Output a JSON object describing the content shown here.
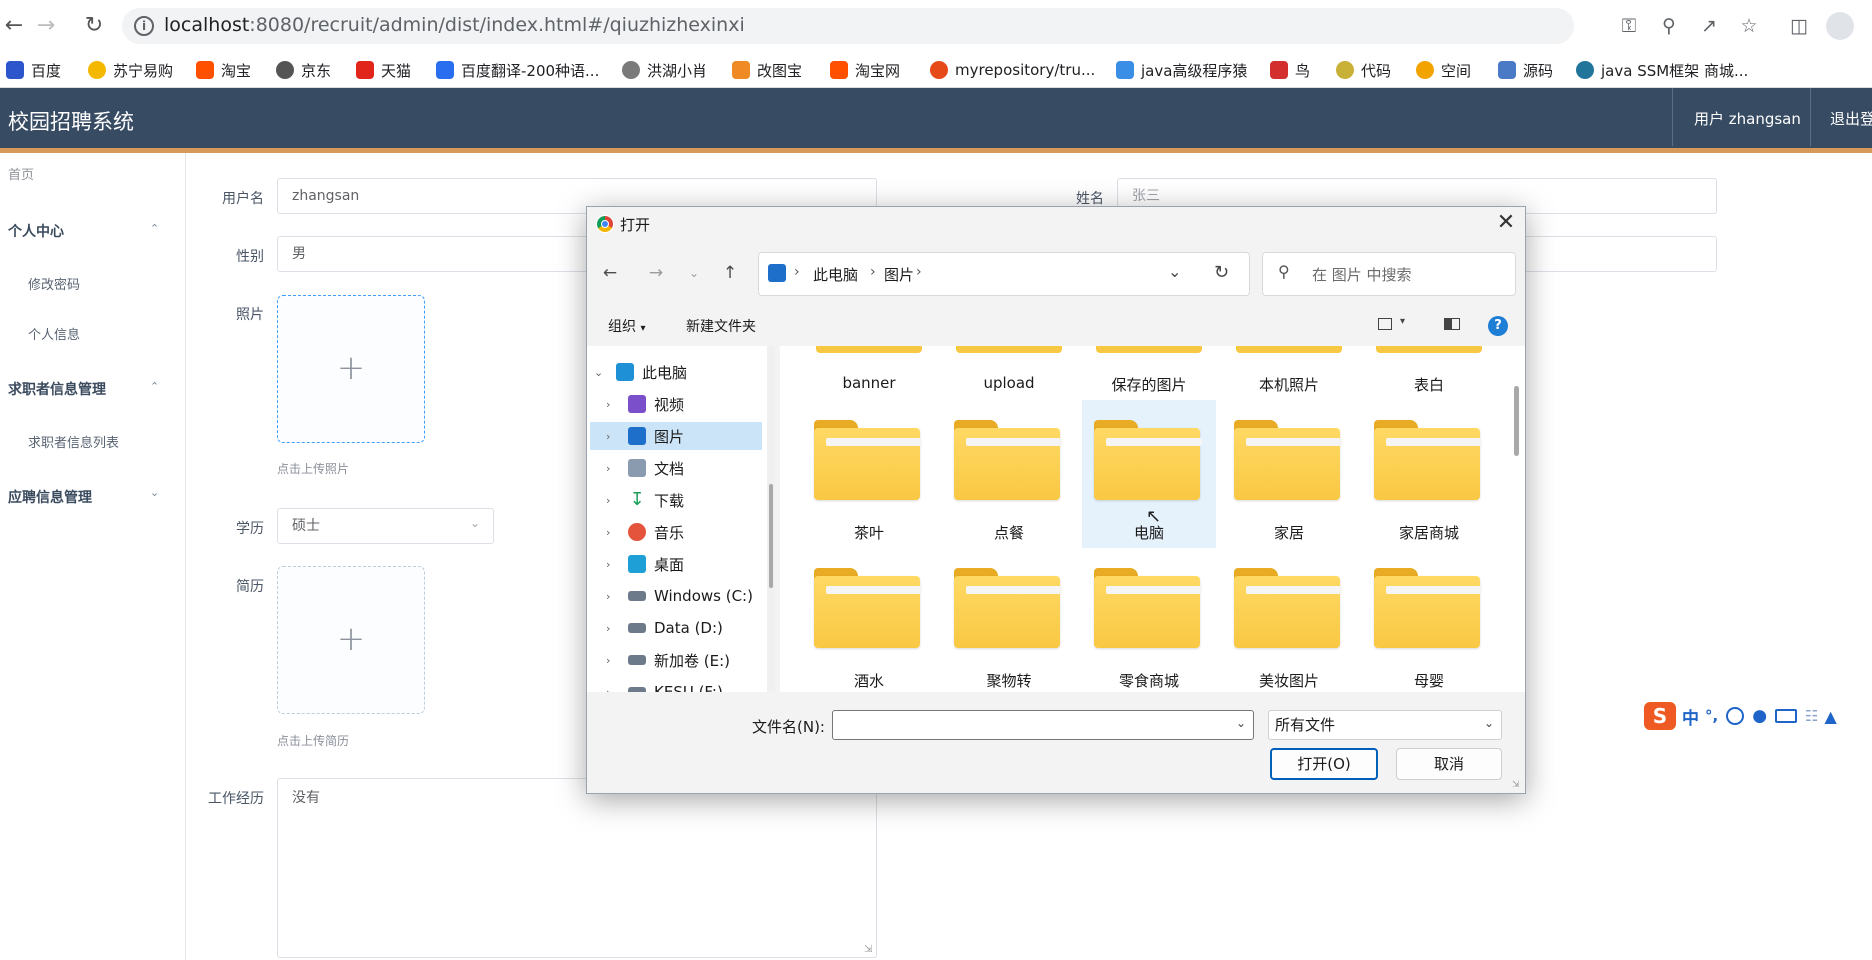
{
  "browser": {
    "url_host": "localhost",
    "url_path": ":8080/recruit/admin/dist/index.html#/qiuzhizhexinxi",
    "bookmarks": [
      {
        "label": "百度",
        "color": "#2d55cc"
      },
      {
        "label": "苏宁易购",
        "color": "#f5b800"
      },
      {
        "label": "淘宝",
        "color": "#ff5000"
      },
      {
        "label": "京东",
        "color": "#555555"
      },
      {
        "label": "天猫",
        "color": "#e1251b"
      },
      {
        "label": "百度翻译-200种语...",
        "color": "#2a6ef0"
      },
      {
        "label": "洪湖小肖",
        "color": "#7a7a7a"
      },
      {
        "label": "改图宝",
        "color": "#f08a24"
      },
      {
        "label": "淘宝网",
        "color": "#ff5000"
      },
      {
        "label": "myrepository/tru...",
        "color": "#e64a19"
      },
      {
        "label": "java高级程序猿",
        "color": "#3a8ee6"
      },
      {
        "label": "鸟",
        "color": "#d32f2f"
      },
      {
        "label": "代码",
        "color": "#c9b037"
      },
      {
        "label": "空间",
        "color": "#f2a300"
      },
      {
        "label": "源码",
        "color": "#4a7ac6"
      },
      {
        "label": "java SSM框架 商城...",
        "color": "#21759b"
      }
    ]
  },
  "app": {
    "title": "校园招聘系统",
    "user_label": "用户 zhangsan",
    "logout_label": "退出登录",
    "header_color": "#374b63",
    "accent_color": "#d59a5a"
  },
  "sidebar": {
    "home": "首页",
    "groups": [
      {
        "label": "个人中心",
        "items": [
          "修改密码",
          "个人信息"
        ]
      },
      {
        "label": "求职者信息管理",
        "items": [
          "求职者信息列表"
        ]
      },
      {
        "label": "应聘信息管理",
        "items": []
      }
    ]
  },
  "form": {
    "username_label": "用户名",
    "username_value": "zhangsan",
    "name_label": "姓名",
    "name_value": "张三",
    "gender_label": "性别",
    "gender_value": "男",
    "photo_label": "照片",
    "photo_hint": "点击上传照片",
    "education_label": "学历",
    "education_value": "硕士",
    "resume_label": "简历",
    "resume_hint": "点击上传简历",
    "experience_label": "工作经历",
    "experience_value": "没有"
  },
  "dialog": {
    "title": "打开",
    "breadcrumb": [
      "此电脑",
      "图片"
    ],
    "search_placeholder": "在 图片 中搜索",
    "organize_label": "组织",
    "new_folder_label": "新建文件夹",
    "tree": [
      {
        "label": "此电脑",
        "icon": "computer-icon",
        "color": "#1e90d6",
        "expanded": true
      },
      {
        "label": "视频",
        "icon": "video-icon",
        "color": "#7b4fc9"
      },
      {
        "label": "图片",
        "icon": "pictures-icon",
        "color": "#1e6fc9",
        "selected": true
      },
      {
        "label": "文档",
        "icon": "documents-icon",
        "color": "#8a9bb0"
      },
      {
        "label": "下载",
        "icon": "download-icon",
        "color": "#1a9e5a"
      },
      {
        "label": "音乐",
        "icon": "music-icon",
        "color": "#e4533c"
      },
      {
        "label": "桌面",
        "icon": "desktop-icon",
        "color": "#1ea0d6"
      },
      {
        "label": "Windows (C:)",
        "icon": "drive-icon",
        "color": "#6c7a89"
      },
      {
        "label": "Data (D:)",
        "icon": "drive-icon",
        "color": "#6c7a89"
      },
      {
        "label": "新加卷 (E:)",
        "icon": "drive-icon",
        "color": "#6c7a89"
      },
      {
        "label": "KESU (F:)",
        "icon": "drive-icon",
        "color": "#6c7a89"
      }
    ],
    "folders_row1": [
      "banner",
      "upload",
      "保存的图片",
      "本机照片",
      "表白"
    ],
    "folders_row2": [
      "茶叶",
      "点餐",
      "电脑",
      "家居",
      "家居商城"
    ],
    "folders_row3": [
      "酒水",
      "聚物转",
      "零食商城",
      "美妆图片",
      "母婴"
    ],
    "selected_folder": "电脑",
    "filename_label": "文件名(N):",
    "filename_value": "",
    "filetype_value": "所有文件",
    "open_button": "打开(O)",
    "cancel_button": "取消"
  },
  "ime": {
    "lang_label": "中",
    "punct_label": "°,"
  }
}
